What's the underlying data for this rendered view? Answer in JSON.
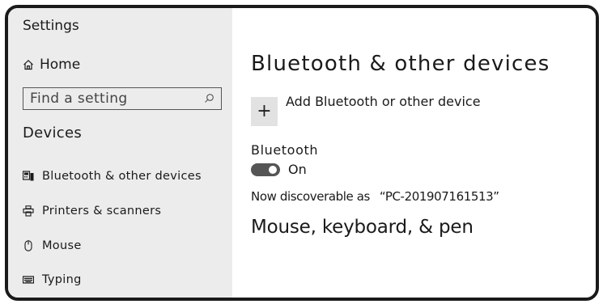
{
  "window": {
    "app_title": "Settings"
  },
  "sidebar": {
    "home_label": "Home",
    "search": {
      "placeholder": "Find a setting"
    },
    "section_heading": "Devices",
    "items": [
      {
        "label": "Bluetooth & other  devices",
        "icon": "bluetooth-devices-icon"
      },
      {
        "label": "Printers & scanners",
        "icon": "printer-icon"
      },
      {
        "label": "Mouse",
        "icon": "mouse-icon"
      },
      {
        "label": "Typing",
        "icon": "keyboard-icon"
      }
    ]
  },
  "main": {
    "page_title": "Bluetooth & other  devices",
    "add_button_symbol": "+",
    "add_device_label": "Add Bluetooth or other device",
    "bluetooth_heading": "Bluetooth",
    "bluetooth_toggle": {
      "state_label": "On",
      "on": true
    },
    "discoverable_prefix": "Now discoverable as",
    "pc_name": "“PC-201907161513”",
    "section_mouse_keyboard_pen": "Mouse, keyboard, & pen"
  },
  "colors": {
    "sidebar_bg": "#ececec",
    "main_bg": "#ffffff",
    "text": "#1a1a1a",
    "toggle_on": "#555555"
  }
}
